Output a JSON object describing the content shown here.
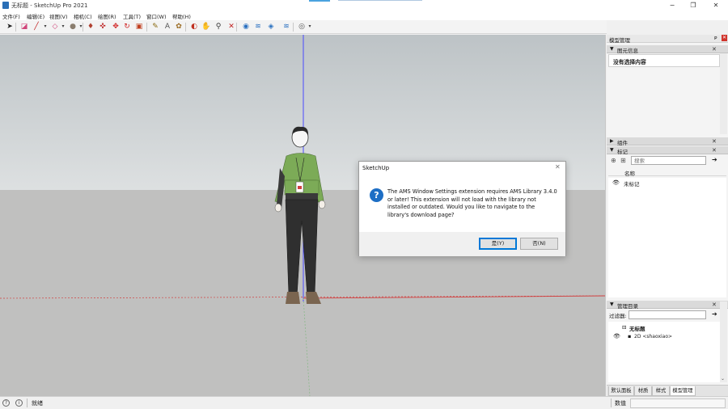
{
  "window": {
    "title": "无标题 - SketchUp Pro 2021",
    "minimize": "−",
    "maximize": "❐",
    "close": "✕"
  },
  "menu": [
    "文件(F)",
    "编辑(E)",
    "视图(V)",
    "相机(C)",
    "绘图(R)",
    "工具(T)",
    "窗口(W)",
    "帮助(H)"
  ],
  "toolbar": {
    "tools": [
      {
        "name": "select-tool-icon",
        "glyph": "➤",
        "color": "#222"
      },
      {
        "name": "eraser-tool-icon",
        "glyph": "◪",
        "color": "#d0457a"
      },
      {
        "name": "line-tool-icon",
        "glyph": "╱",
        "color": "#c02020"
      },
      {
        "name": "line-dropdown-icon",
        "glyph": "▾",
        "color": "#444"
      },
      {
        "name": "shape-tool-icon",
        "glyph": "◇",
        "color": "#d0457a"
      },
      {
        "name": "shape-dropdown-icon",
        "glyph": "▾",
        "color": "#444"
      },
      {
        "name": "paint-bucket-icon",
        "glyph": "●",
        "color": "#8a7d6e"
      },
      {
        "name": "paint-dropdown-icon",
        "glyph": "▾",
        "color": "#444"
      },
      {
        "name": "push-pull-icon",
        "glyph": "♦",
        "color": "#b04030"
      },
      {
        "name": "follow-me-icon",
        "glyph": "✜",
        "color": "#c03030"
      },
      {
        "name": "move-tool-icon",
        "glyph": "✥",
        "color": "#d02020"
      },
      {
        "name": "rotate-tool-icon",
        "glyph": "↻",
        "color": "#d02020"
      },
      {
        "name": "scale-tool-icon",
        "glyph": "▣",
        "color": "#c04020"
      },
      {
        "name": "tape-measure-icon",
        "glyph": "✎",
        "color": "#8a6a10"
      },
      {
        "name": "text-tool-icon",
        "glyph": "A",
        "color": "#555"
      },
      {
        "name": "paint-tool-icon",
        "glyph": "✿",
        "color": "#9a6a20"
      },
      {
        "name": "orbit-tool-icon",
        "glyph": "◐",
        "color": "#c03020"
      },
      {
        "name": "pan-tool-icon",
        "glyph": "✋",
        "color": "#c08020"
      },
      {
        "name": "zoom-tool-icon",
        "glyph": "⚲",
        "color": "#333"
      },
      {
        "name": "zoom-extents-icon",
        "glyph": "✕",
        "color": "#c02020"
      },
      {
        "name": "warehouse-icon",
        "glyph": "◉",
        "color": "#2a70c0"
      },
      {
        "name": "extension-warehouse-icon",
        "glyph": "≋",
        "color": "#2a70c0"
      },
      {
        "name": "layout-icon",
        "glyph": "◈",
        "color": "#2a70c0"
      },
      {
        "name": "extension-manager-icon",
        "glyph": "≋",
        "color": "#2a70c0"
      },
      {
        "name": "account-icon",
        "glyph": "◎",
        "color": "#555"
      },
      {
        "name": "account-dropdown-icon",
        "glyph": "▾",
        "color": "#444"
      }
    ]
  },
  "dialog": {
    "title": "SketchUp",
    "close": "✕",
    "icon": "?",
    "message": "The AMS Window Settings extension requires AMS Library 3.4.0 or later! This extension will not load with the library not installed or outdated. Would you like to navigate to the library's download page?",
    "yes_label": "是(Y)",
    "no_label": "否(N)"
  },
  "panel": {
    "title": "模型管理",
    "entity_info": {
      "header": "图元信息",
      "text": "没有选择内容"
    },
    "components": {
      "header": "组件"
    },
    "tags": {
      "header": "标记",
      "search_placeholder": "搜索",
      "column_name": "名称",
      "rows": [
        "未标记"
      ]
    },
    "outliner": {
      "header": "管理目录",
      "filter_label": "过滤器:",
      "root": "无标题",
      "child": "2D <shaoxiao>"
    },
    "tabs": [
      "默认面板",
      "材质",
      "样式",
      "模型管理"
    ]
  },
  "status": {
    "text": "就绪",
    "measurements_label": "数值"
  },
  "colors": {
    "axis_blue": "#4a4aff",
    "axis_red": "#d04040",
    "axis_green": "#40a040",
    "dialog_accent": "#0078d7"
  }
}
